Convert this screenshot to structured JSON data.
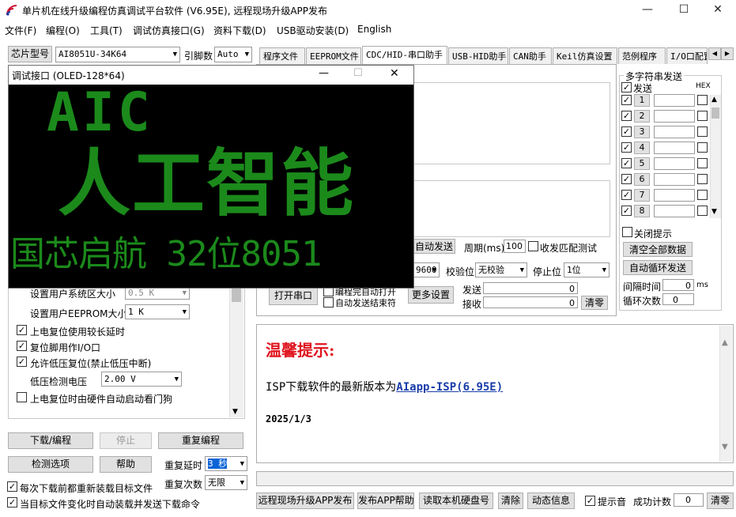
{
  "window": {
    "title": "单片机在线升级编程仿真调试平台软件 (V6.95E), 远程现场升级APP发布",
    "minimize_glyph": "—",
    "maximize_glyph": "☐",
    "close_glyph": "✕"
  },
  "menu": [
    "文件(F)",
    "编程(O)",
    "工具(T)",
    "调试仿真接口(G)",
    "资料下载(D)",
    "USB驱动安装(D)",
    "English"
  ],
  "left": {
    "chip_label": "芯片型号",
    "chip_value": "AI8051U-34K64",
    "pin_label": "引脚数",
    "pin_value": "Auto",
    "sys_freq_label": "设置用户系统区大小",
    "sys_freq_value": "0.5 K",
    "eeprom_label": "设置用户EEPROM大小",
    "eeprom_value": "1  K",
    "opt_delay": "上电复位使用较长延时",
    "opt_reset_io": "复位脚用作I/O口",
    "opt_lvr": "允许低压复位(禁止低压中断)",
    "lvd_label": "低压检测电压",
    "lvd_value": "2.00 V",
    "opt_wdt": "上电复位时由硬件自动启动看门狗",
    "btn_download": "下载/编程",
    "btn_stop": "停止",
    "btn_reprogram": "重复编程",
    "btn_check": "检测选项",
    "btn_help": "帮助",
    "repeat_delay_label": "重复延时",
    "repeat_delay_value": "3 秒",
    "repeat_count_label": "重复次数",
    "repeat_count_value": "无限",
    "opt_reload": "每次下载前都重新装载目标文件",
    "opt_autosend": "当目标文件变化时自动装载并发送下载命令"
  },
  "tabs": [
    "程序文件",
    "EEPROM文件",
    "CDC/HID-串口助手",
    "USB-HID助手",
    "CAN助手",
    "Keil仿真设置",
    "范例程序",
    "I/O口配置"
  ],
  "tab_scroll": {
    "left": "◀",
    "right": "▶"
  },
  "serial": {
    "auto_send": "自动发送",
    "period_label": "周期(ms)",
    "period_value": "100",
    "match_test": "收发匹配测试",
    "baud_value": "9600",
    "parity_label": "校验位",
    "parity_value": "无校验",
    "stop_label": "停止位",
    "stop_value": "1位",
    "open_port": "打开串口",
    "opt_auto_open": "编程完自动打开",
    "opt_auto_send_end": "自动发送结束符",
    "more_settings": "更多设置",
    "send_label": "发送",
    "send_count": "0",
    "recv_label": "接收",
    "recv_count": "0",
    "clear": "清零"
  },
  "multi": {
    "group_title": "多字符串发送",
    "send_header": "发送",
    "hex_header": "HEX",
    "rows": [
      "1",
      "2",
      "3",
      "4",
      "5",
      "6",
      "7",
      "8"
    ],
    "close_tip": "关闭提示",
    "clear_all": "清空全部数据",
    "auto_loop": "自动循环发送",
    "interval_label": "间隔时间",
    "interval_value": "0",
    "interval_unit": "ms",
    "loop_label": "循环次数",
    "loop_value": "0"
  },
  "oled": {
    "title": "调试接口 (OLED-128*64)",
    "line1": "AIC",
    "line2": "人工智能",
    "line3": "国芯启航 32位8051"
  },
  "hint": {
    "title": "温馨提示:",
    "line_prefix": "ISP下载软件的最新版本为",
    "link": "AIapp-ISP(6.95E)",
    "date": "2025/1/3"
  },
  "bottom": {
    "btn_remote": "远程现场升级APP发布",
    "btn_app_help": "发布APP帮助",
    "btn_read_disk": "读取本机硬盘号",
    "btn_clear": "清除",
    "btn_anim": "动态信息",
    "beep_label": "提示音",
    "success_label": "成功计数",
    "success_value": "0",
    "btn_reset": "清零"
  },
  "colors": {
    "oled_green": "#1b8a1b",
    "hint_red": "#e0141e",
    "link_blue": "#1a3ea8"
  }
}
